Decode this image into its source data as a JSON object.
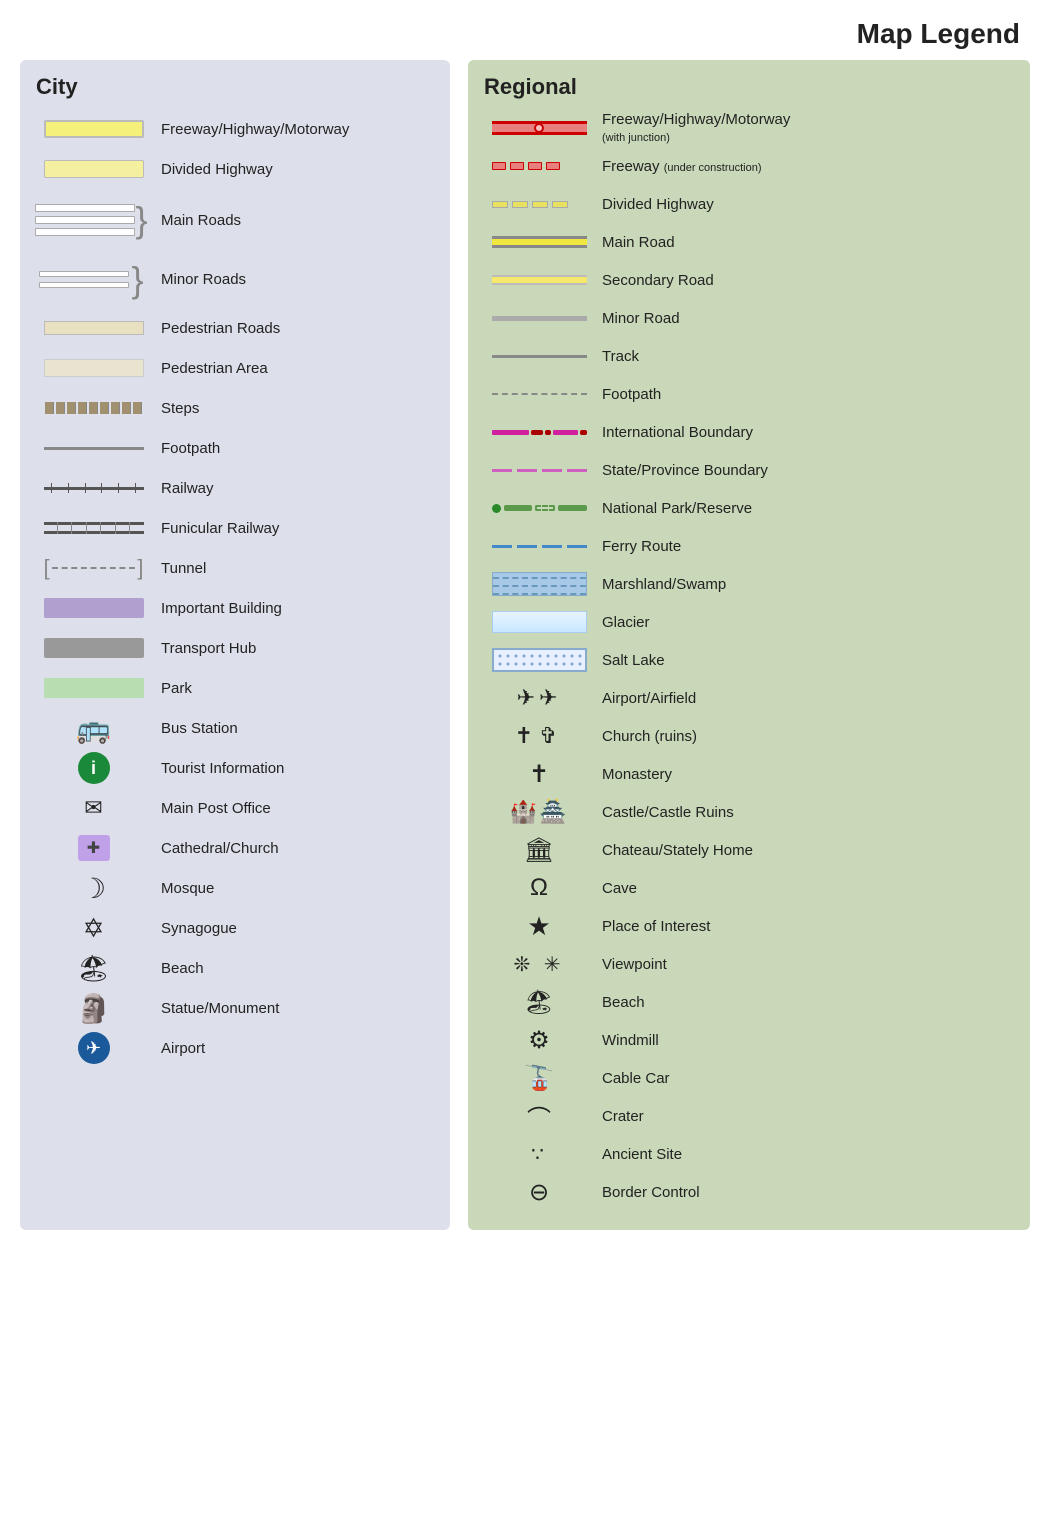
{
  "title": "Map Legend",
  "city": {
    "heading": "City",
    "items": [
      {
        "id": "city-freeway",
        "label": "Freeway/Highway/Motorway"
      },
      {
        "id": "city-divided",
        "label": "Divided Highway"
      },
      {
        "id": "city-main-roads",
        "label": "Main Roads"
      },
      {
        "id": "city-minor-roads",
        "label": "Minor Roads"
      },
      {
        "id": "city-pedestrian-roads",
        "label": "Pedestrian Roads"
      },
      {
        "id": "city-pedestrian-area",
        "label": "Pedestrian Area"
      },
      {
        "id": "city-steps",
        "label": "Steps"
      },
      {
        "id": "city-footpath",
        "label": "Footpath"
      },
      {
        "id": "city-railway",
        "label": "Railway"
      },
      {
        "id": "city-funicular",
        "label": "Funicular Railway"
      },
      {
        "id": "city-tunnel",
        "label": "Tunnel"
      },
      {
        "id": "city-important-building",
        "label": "Important Building"
      },
      {
        "id": "city-transport-hub",
        "label": "Transport Hub"
      },
      {
        "id": "city-park",
        "label": "Park"
      },
      {
        "id": "city-bus-station",
        "label": "Bus Station"
      },
      {
        "id": "city-tourist-info",
        "label": "Tourist Information"
      },
      {
        "id": "city-post-office",
        "label": "Main Post Office"
      },
      {
        "id": "city-cathedral",
        "label": "Cathedral/Church"
      },
      {
        "id": "city-mosque",
        "label": "Mosque"
      },
      {
        "id": "city-synagogue",
        "label": "Synagogue"
      },
      {
        "id": "city-beach",
        "label": "Beach"
      },
      {
        "id": "city-statue",
        "label": "Statue/Monument"
      },
      {
        "id": "city-airport",
        "label": "Airport"
      }
    ]
  },
  "regional": {
    "heading": "Regional",
    "items": [
      {
        "id": "reg-freeway",
        "label": "Freeway/Highway/Motorway",
        "sublabel": "(with junction)"
      },
      {
        "id": "reg-freeway-construction",
        "label": "Freeway",
        "sublabel": "(under construction)"
      },
      {
        "id": "reg-divided",
        "label": "Divided Highway"
      },
      {
        "id": "reg-main-road",
        "label": "Main Road"
      },
      {
        "id": "reg-secondary",
        "label": "Secondary Road"
      },
      {
        "id": "reg-minor",
        "label": "Minor Road"
      },
      {
        "id": "reg-track",
        "label": "Track"
      },
      {
        "id": "reg-footpath",
        "label": "Footpath"
      },
      {
        "id": "reg-intl-boundary",
        "label": "International Boundary"
      },
      {
        "id": "reg-state-boundary",
        "label": "State/Province Boundary"
      },
      {
        "id": "reg-natpark",
        "label": "National Park/Reserve"
      },
      {
        "id": "reg-ferry",
        "label": "Ferry Route"
      },
      {
        "id": "reg-marsh",
        "label": "Marshland/Swamp"
      },
      {
        "id": "reg-glacier",
        "label": "Glacier"
      },
      {
        "id": "reg-saltlake",
        "label": "Salt Lake"
      },
      {
        "id": "reg-airport",
        "label": "Airport/Airfield"
      },
      {
        "id": "reg-church",
        "label": "Church (ruins)"
      },
      {
        "id": "reg-monastery",
        "label": "Monastery"
      },
      {
        "id": "reg-castle",
        "label": "Castle/Castle Ruins"
      },
      {
        "id": "reg-chateau",
        "label": "Chateau/Stately Home"
      },
      {
        "id": "reg-cave",
        "label": "Cave"
      },
      {
        "id": "reg-place-interest",
        "label": "Place of Interest"
      },
      {
        "id": "reg-viewpoint",
        "label": "Viewpoint"
      },
      {
        "id": "reg-beach",
        "label": "Beach"
      },
      {
        "id": "reg-windmill",
        "label": "Windmill"
      },
      {
        "id": "reg-cablecar",
        "label": "Cable Car"
      },
      {
        "id": "reg-crater",
        "label": "Crater"
      },
      {
        "id": "reg-ancient",
        "label": "Ancient Site"
      },
      {
        "id": "reg-border",
        "label": "Border Control"
      }
    ]
  }
}
